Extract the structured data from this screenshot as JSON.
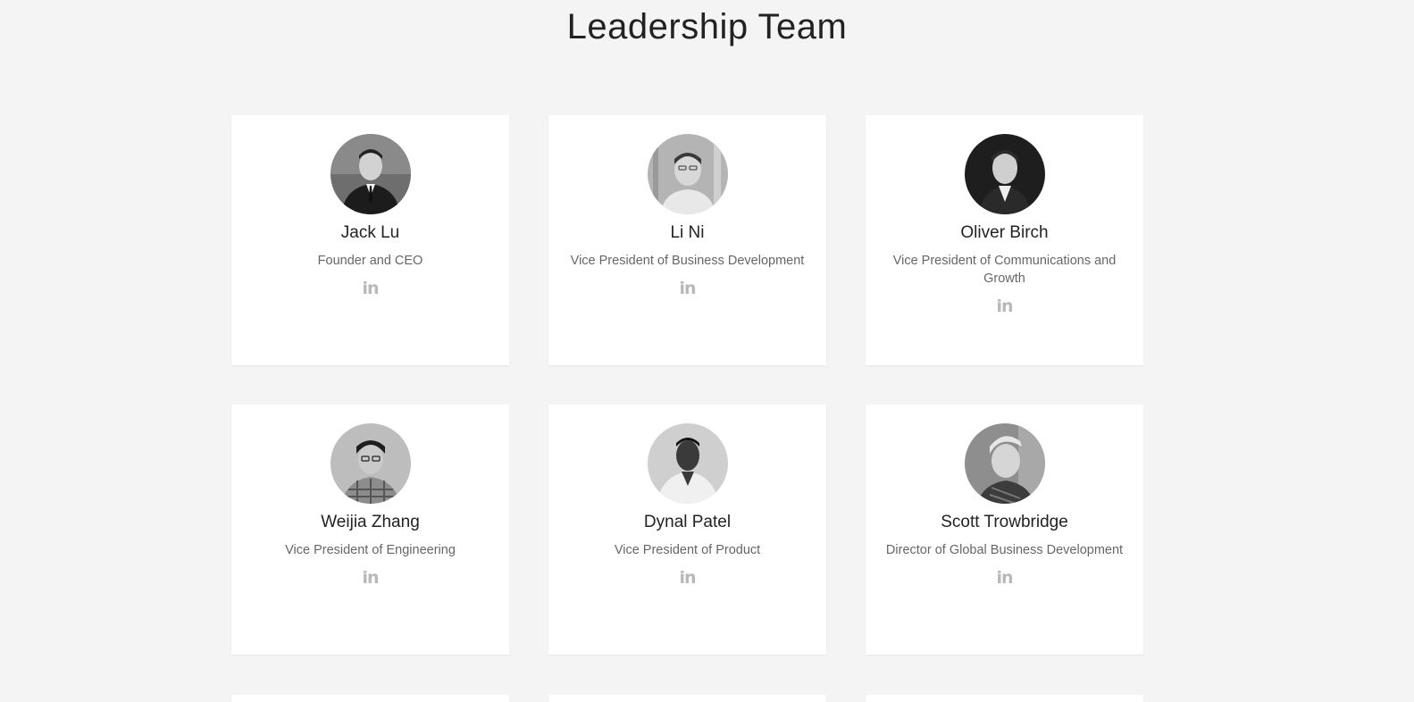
{
  "page": {
    "title": "Leadership Team"
  },
  "team": [
    {
      "name": "Jack Lu",
      "role": "Founder and CEO",
      "linkedin_icon": "in"
    },
    {
      "name": "Li Ni",
      "role": "Vice President of Business Development",
      "linkedin_icon": "in"
    },
    {
      "name": "Oliver Birch",
      "role": "Vice President of Communications and Growth",
      "linkedin_icon": "in"
    },
    {
      "name": "Weijia Zhang",
      "role": "Vice President of Engineering",
      "linkedin_icon": "in"
    },
    {
      "name": "Dynal Patel",
      "role": "Vice President of Product",
      "linkedin_icon": "in"
    },
    {
      "name": "Scott Trowbridge",
      "role": "Director of Global Business Development",
      "linkedin_icon": "in"
    }
  ],
  "icons": {
    "linkedin": "linkedin-icon",
    "avatar": "avatar"
  },
  "colors": {
    "background": "#f4f4f4",
    "card": "#ffffff",
    "title": "#222222",
    "role_text": "#666666",
    "icon": "#b8b8b8"
  }
}
